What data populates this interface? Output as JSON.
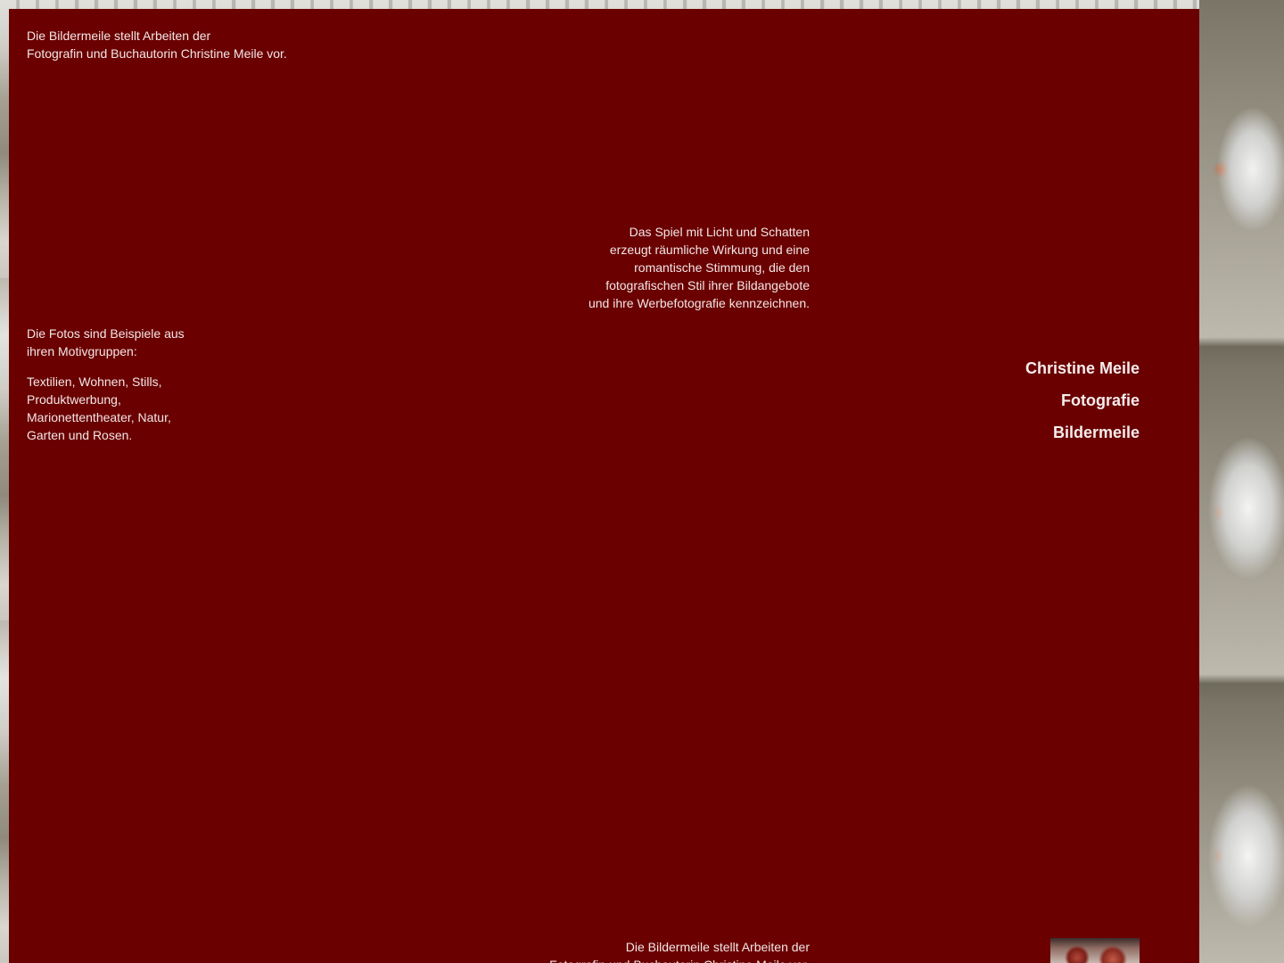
{
  "intro": {
    "lines": [
      "Die Bildermeile stellt Arbeiten der",
      "Fotografin und Buchautorin Christine Meile vor."
    ]
  },
  "light_shadow": {
    "lines": [
      "Das Spiel mit Licht und Schatten",
      "erzeugt räumliche Wirkung und eine",
      "romantische Stimmung, die den",
      "fotografischen Stil ihrer Bildangebote",
      "und ihre Werbefotografie kennzeichnen."
    ]
  },
  "motifs_intro": {
    "lines": [
      "Die Fotos sind Beispiele aus",
      "ihren Motivgruppen:"
    ]
  },
  "motifs_list": {
    "lines": [
      "Textilien, Wohnen, Stills,",
      "Produktwerbung,",
      "Marionettentheater, Natur,",
      "Garten und Rosen."
    ]
  },
  "nav": {
    "items": [
      "Christine Meile",
      "Fotografie",
      "Bildermeile"
    ]
  },
  "bottom_repeat": {
    "lines": [
      "Die Bildermeile stellt Arbeiten der",
      "Fotografin und Buchautorin Christine Meile vor."
    ]
  },
  "colors": {
    "panel_background": "#6a0000",
    "text": "#f3e6e6"
  }
}
